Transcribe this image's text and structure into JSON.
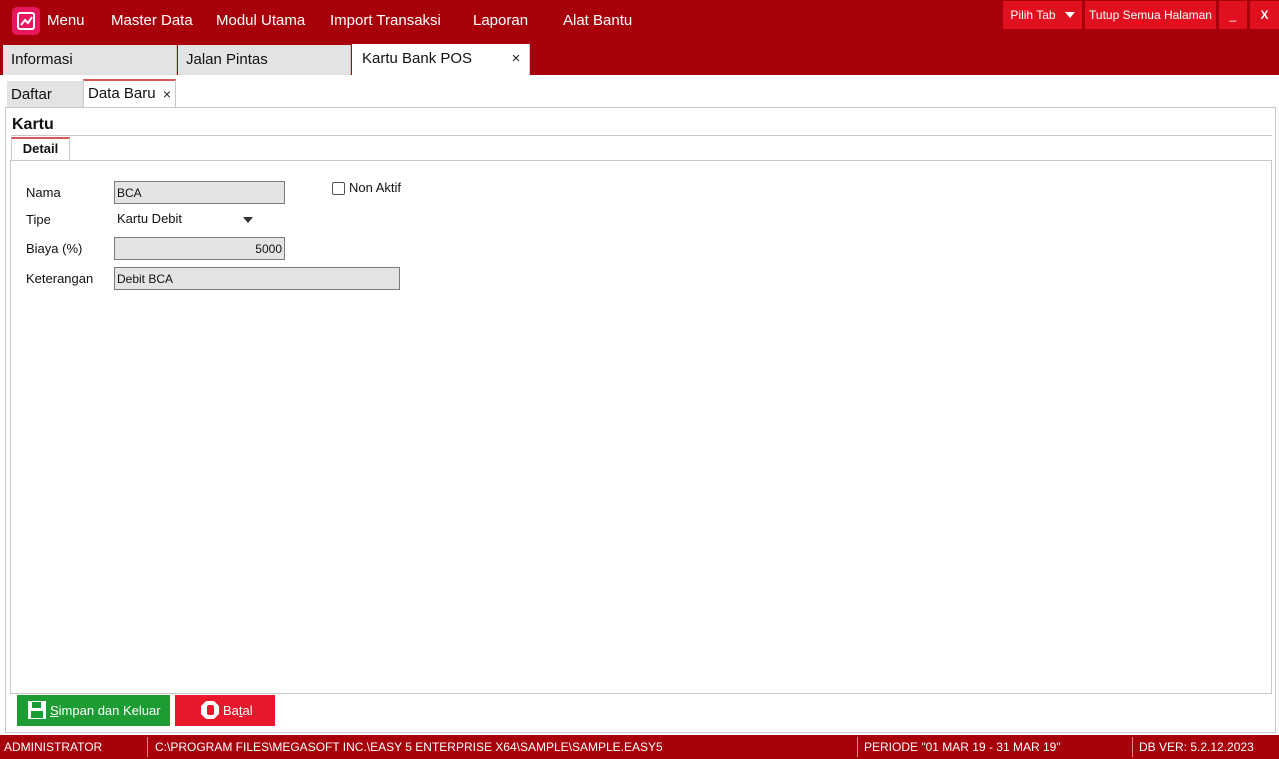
{
  "menu": {
    "items": [
      {
        "label": "Menu"
      },
      {
        "label": "Master Data"
      },
      {
        "label": "Modul Utama"
      },
      {
        "label": "Import Transaksi"
      },
      {
        "label": "Laporan"
      },
      {
        "label": "Alat Bantu"
      }
    ]
  },
  "toolbar": {
    "pick_tab": "Pilih Tab",
    "close_all": "Tutup Semua Halaman",
    "minimize": "_",
    "close": "X"
  },
  "main_tabs": [
    {
      "label": "Informasi"
    },
    {
      "label": "Jalan Pintas"
    },
    {
      "label": "Kartu Bank POS",
      "close": "×"
    }
  ],
  "sub_tabs": [
    {
      "label": "Daftar"
    },
    {
      "label": "Data Baru",
      "close": "×"
    }
  ],
  "form": {
    "section_title": "Kartu",
    "tab": "Detail",
    "fields": {
      "nama": {
        "label": "Nama",
        "value": "BCA"
      },
      "tipe": {
        "label": "Tipe",
        "value": "Kartu Debit"
      },
      "biaya": {
        "label": "Biaya (%)",
        "value": "5000"
      },
      "keterangan": {
        "label": "Keterangan",
        "value": "Debit BCA"
      }
    },
    "non_aktif": {
      "label": "Non Aktif",
      "checked": false
    }
  },
  "actions": {
    "save_prefix": "S",
    "save_rest": "impan dan Keluar",
    "cancel_a": "Ba",
    "cancel_b": "t",
    "cancel_c": "al"
  },
  "status": {
    "user": "ADMINISTRATOR",
    "path": "C:\\PROGRAM FILES\\MEGASOFT INC.\\EASY 5 ENTERPRISE X64\\SAMPLE\\SAMPLE.EASY5",
    "period": "PERIODE \"01 MAR 19 - 31 MAR 19\"",
    "db_version": "DB VER: 5.2.12.2023"
  },
  "colors": {
    "brand": "#a8000b",
    "accent": "#e0101f",
    "save": "#1e9c34",
    "cancel": "#e8172c"
  },
  "icons": {
    "logo": "chart-logo-icon",
    "save": "floppy-disk-icon",
    "cancel": "stop-hand-icon"
  }
}
